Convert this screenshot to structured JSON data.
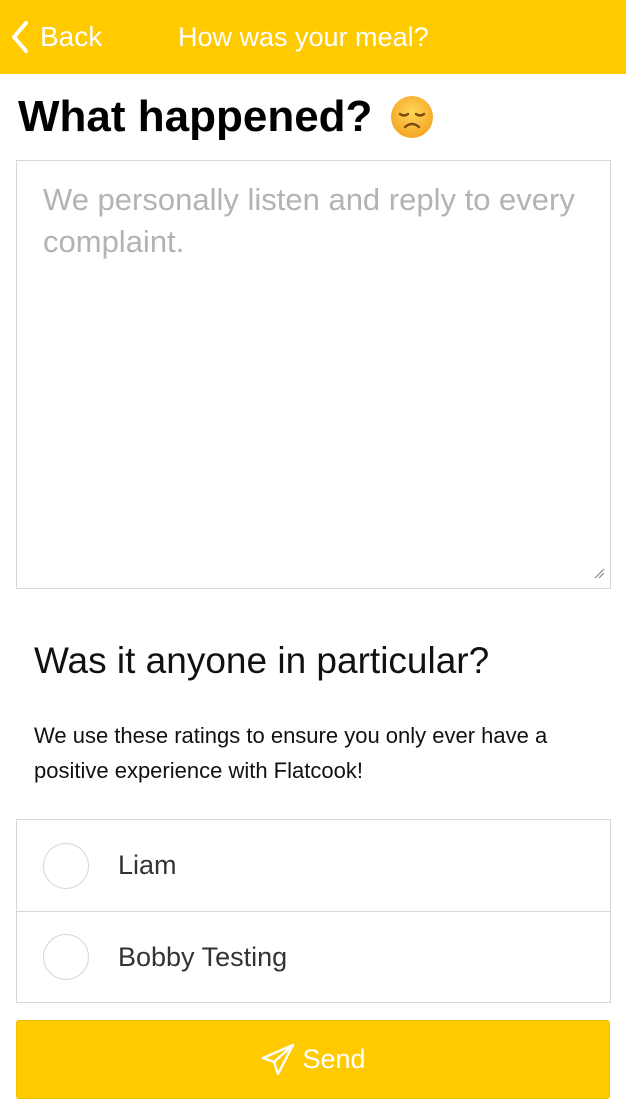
{
  "navbar": {
    "back_label": "Back",
    "title": "How was your meal?",
    "background_color": "#ffca00"
  },
  "heading": {
    "text": "What happened?",
    "emoji_icon": "disappointed-face-emoji"
  },
  "complaint": {
    "placeholder": "We personally listen and reply to every complaint.",
    "value": ""
  },
  "people_section": {
    "title": "Was it anyone in particular?",
    "description": "We use these ratings to ensure you only ever have a positive experience with Flatcook!",
    "people": [
      {
        "name": "Liam",
        "selected": false
      },
      {
        "name": "Bobby Testing",
        "selected": false
      }
    ]
  },
  "send_button": {
    "label": "Send",
    "icon": "paper-plane-icon",
    "color": "#ffca00"
  }
}
